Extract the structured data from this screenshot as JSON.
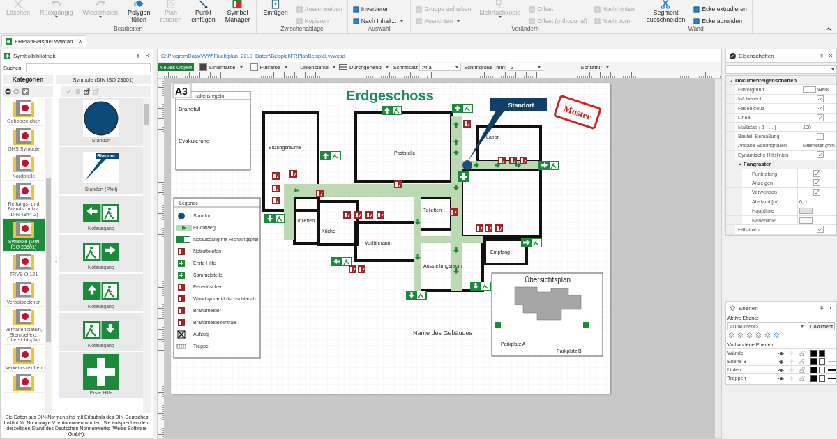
{
  "ribbon": {
    "groups": [
      {
        "label": "Bearbeiten",
        "items": [
          {
            "kind": "large",
            "label": "Löschen",
            "disabled": true,
            "dropdown": false
          },
          {
            "kind": "large",
            "label": "Rückgängig",
            "disabled": true,
            "dropdown": true
          },
          {
            "kind": "large",
            "label": "Wiederholen",
            "disabled": true,
            "dropdown": true
          },
          {
            "kind": "large",
            "label": "Polygon füllen",
            "disabled": false,
            "dropdown": false
          },
          {
            "kind": "large",
            "label": "Plan rotieren",
            "disabled": true,
            "dropdown": false
          },
          {
            "kind": "large",
            "label": "Punkt einfügen",
            "disabled": false,
            "dropdown": false
          },
          {
            "kind": "large",
            "label": "Symbol Manager",
            "disabled": false,
            "dropdown": false
          }
        ]
      },
      {
        "label": "Zwischenablage",
        "items": [
          {
            "kind": "large",
            "label": "Einfügen",
            "disabled": false,
            "dropdown": false
          },
          {
            "kind": "column",
            "items": [
              {
                "label": "Ausschneiden",
                "disabled": true,
                "dropdown": false
              },
              {
                "label": "Kopieren",
                "disabled": true,
                "dropdown": false
              }
            ]
          }
        ]
      },
      {
        "label": "Auswahl",
        "items": [
          {
            "kind": "column",
            "items": [
              {
                "label": "Invertieren",
                "disabled": false,
                "dropdown": false
              },
              {
                "label": "Nach Inhalt...",
                "disabled": false,
                "dropdown": true
              }
            ]
          }
        ]
      },
      {
        "label": "Verändern",
        "items": [
          {
            "kind": "column",
            "items": [
              {
                "label": "Gruppe aufheben",
                "disabled": true,
                "dropdown": false
              },
              {
                "label": "Ausrichten",
                "disabled": true,
                "dropdown": true
              }
            ]
          },
          {
            "kind": "large",
            "label": "Mehrfachkopie",
            "disabled": true,
            "dropdown": true
          },
          {
            "kind": "column",
            "items": [
              {
                "label": "Offset",
                "disabled": true,
                "dropdown": false
              },
              {
                "label": "Offset (orthogonal)",
                "disabled": true,
                "dropdown": false
              }
            ]
          },
          {
            "kind": "column",
            "items": [
              {
                "label": "Nach hinten",
                "disabled": true,
                "dropdown": false
              },
              {
                "label": "Nach vorn",
                "disabled": true,
                "dropdown": false
              }
            ]
          }
        ]
      },
      {
        "label": "Wand",
        "items": [
          {
            "kind": "large",
            "label": "Segment ausschneiden",
            "disabled": false,
            "dropdown": false
          },
          {
            "kind": "column",
            "items": [
              {
                "label": "Ecke extrudieren",
                "disabled": false,
                "dropdown": false
              },
              {
                "label": "Ecke abrunden",
                "disabled": false,
                "dropdown": false
              }
            ]
          }
        ]
      }
    ]
  },
  "document_tab": {
    "label": "FRPlanBeispiel.vvwcad"
  },
  "symbol_library": {
    "title": "Symbolbibliothek",
    "search_label": "Suchen:",
    "categories_header": "Kategorien",
    "symbols_header": "Symbole (DIN ISO 23601)",
    "categories": [
      {
        "label": "Gebotszeichen",
        "selected": false
      },
      {
        "label": "GHS Symbole",
        "selected": false
      },
      {
        "label": "Nordpfeile",
        "selected": false
      },
      {
        "label": "Rettungs- und Brandschutzz. (DIN 4844-2)",
        "selected": false
      },
      {
        "label": "Symbole (DIN ISO 23601)",
        "selected": true
      },
      {
        "label": "TRVB O 121",
        "selected": false
      },
      {
        "label": "Verbotszeichen",
        "selected": false
      },
      {
        "label": "Verhaltenstafeln, Stempelfeld, Übersichtsplan",
        "selected": false
      },
      {
        "label": "Verkehrszeichen",
        "selected": false
      },
      {
        "selected": false
      }
    ],
    "symbols": [
      {
        "kind": "circle",
        "label": "Standort"
      },
      {
        "kind": "callout",
        "label": "Standort (Pfeil)",
        "callout_text": "Standort"
      },
      {
        "kind": "exit-left",
        "label": "Notausgang"
      },
      {
        "kind": "exit-right",
        "label": "Notausgang"
      },
      {
        "kind": "exit-up",
        "label": "Notausgang"
      },
      {
        "kind": "exit-down",
        "label": "Notausgang"
      },
      {
        "kind": "first-aid",
        "label": "Erste Hilfe"
      }
    ],
    "footer": "Die Daten aus DIN-Normen sind mit Erlaubnis des DIN Deutsches Institut für Normung e.V. entnommen worden. Sie entsprechen dem derzeitigen Stand des Deutschen Normenwerks (Weise Software GmbH)."
  },
  "path": "C:\\ProgramData\\VVW\\Fluchtplan_2019_Daten\\Beispiel\\FRPlanBeispiel.vvwcad",
  "format_toolbar": {
    "new_object": "Neues Objekt",
    "line_color": "Linienfarbe",
    "fill_color": "Füllfarbe",
    "line_width": "Linienstärke",
    "line_style": "Durchgehend",
    "font_label": "Schriftsatz",
    "font": "Arial",
    "font_size_label": "Schriftgröße (mm)",
    "font_size": "3",
    "hatch": "Schraffur"
  },
  "plan": {
    "paper": "A3",
    "title": "Erdgeschoss",
    "location": "Standort",
    "stamp": "Muster",
    "rules": {
      "title": "haltensregeln",
      "sections": [
        {
          "heading": "Brandfall"
        },
        {
          "heading": "Evakuierung"
        }
      ]
    },
    "rooms": [
      {
        "label": "Sitzungsräume"
      },
      {
        "label": "Poststelle"
      },
      {
        "label": "Labor"
      },
      {
        "label": "Toiletten"
      },
      {
        "label": "Küche"
      },
      {
        "label": "Toiletten"
      },
      {
        "label": "Vorführraum"
      },
      {
        "label": "Ausstellungsraum"
      },
      {
        "label": "Empfang"
      }
    ],
    "legend": {
      "title": "Legende",
      "items": [
        {
          "kind": "location",
          "label": "Standort"
        },
        {
          "kind": "route",
          "label": "Fluchtweg"
        },
        {
          "kind": "exit",
          "label": "Notausgang mit Richtungspfeil"
        },
        {
          "kind": "phone",
          "label": "Notruftelefon"
        },
        {
          "kind": "first-aid",
          "label": "Erste Hilfe"
        },
        {
          "kind": "assembly",
          "label": "Sammelstelle"
        },
        {
          "kind": "extinguisher",
          "label": "Feuerlöscher"
        },
        {
          "kind": "hydrant",
          "label": "Wandhydrant/Löschschlauch"
        },
        {
          "kind": "alarm",
          "label": "Brandmelder"
        },
        {
          "kind": "alarm",
          "label": "Brandmeldezentrale"
        },
        {
          "kind": "elevator",
          "label": "Aufzug"
        },
        {
          "kind": "stairs",
          "label": "Treppe"
        }
      ]
    },
    "overview": {
      "title": "Übersichtsplan",
      "parking": [
        "Parkplatz A",
        "Parkplatz B"
      ]
    },
    "building_name": "Name des Gebäudes"
  },
  "properties": {
    "title": "Eigenschaften",
    "section": {
      "label": "Dokumenteigenschaften",
      "expanded": true,
      "rows": [
        {
          "kind": "swatch",
          "label": "Hintergrund",
          "color": "#ffffff",
          "value": "Weiß"
        },
        {
          "kind": "check",
          "label": "Infobereich",
          "checked": true
        },
        {
          "kind": "check",
          "label": "Fadenkreuz",
          "checked": true
        },
        {
          "kind": "check",
          "label": "Lineal",
          "checked": true
        },
        {
          "kind": "text",
          "label": "Maßstab ( 1 : ... )",
          "value": "100"
        },
        {
          "kind": "check",
          "label": "Bauteil-Bemaßung",
          "checked": false
        },
        {
          "kind": "text",
          "label": "Angabe Schriftgrößen",
          "value": "Millimeter (mm)"
        },
        {
          "kind": "check",
          "label": "Dynamische Hilfslinien",
          "checked": true
        },
        {
          "kind": "group",
          "label": "Fangraster",
          "expanded": true,
          "rows": [
            {
              "kind": "check",
              "label": "Punktefang",
              "checked": true
            },
            {
              "kind": "check",
              "label": "Anzeigen",
              "checked": true
            },
            {
              "kind": "check",
              "label": "Verwenden",
              "checked": true
            },
            {
              "kind": "text",
              "label": "Abstand [m]",
              "value": "0, 1"
            },
            {
              "kind": "swatch",
              "label": "Hauptlinie",
              "color": "#e2e2e2"
            },
            {
              "kind": "swatch",
              "label": "Nebenlinie",
              "color": "#f6f6f6"
            }
          ]
        },
        {
          "kind": "check",
          "label": "Hilfslinien",
          "checked": true
        }
      ]
    }
  },
  "layers": {
    "title": "Ebenen",
    "active_label": "Aktive Ebene:",
    "active_value": "<Dokument>",
    "active_button": "Dokument",
    "list_label": "Vorhandene Ebenen",
    "rows": [
      {
        "name": "Wände",
        "color": "#000000",
        "thick": false
      },
      {
        "name": "Ebene 8",
        "color": "#ffffff",
        "thick": false
      },
      {
        "name": "Linien",
        "color": "#ffffff",
        "thick": true
      },
      {
        "name": "Treppen",
        "color": "#ffffff",
        "thick": true
      }
    ]
  }
}
